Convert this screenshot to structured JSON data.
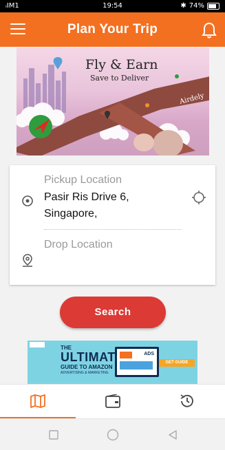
{
  "status_bar": {
    "carrier": "ᵢIM1",
    "time": "19:54",
    "battery": "74%"
  },
  "app_bar": {
    "title": "Plan Your Trip"
  },
  "banner": {
    "headline": "Fly & Earn",
    "subline": "Save to Deliver",
    "brand": "Airdely"
  },
  "trip_form": {
    "pickup_label": "Pickup Location",
    "pickup_value_line1": "Pasir Ris Drive 6,",
    "pickup_value_line2": "Singapore,",
    "drop_label": "Drop Location"
  },
  "search_button": {
    "label": "Search"
  },
  "ad": {
    "line1": "THE",
    "line2": "ULTIMATE",
    "line3": "GUIDE TO AMAZON",
    "line4": "ADVERTISING & MARKETING",
    "screen_label": "ADS",
    "cta": "GET GUIDE"
  },
  "tabs": [
    {
      "icon": "map-icon",
      "active": true
    },
    {
      "icon": "wallet-icon",
      "active": false
    },
    {
      "icon": "history-icon",
      "active": false
    }
  ],
  "colors": {
    "brand_orange": "#f37021",
    "search_red": "#dc3a35"
  }
}
